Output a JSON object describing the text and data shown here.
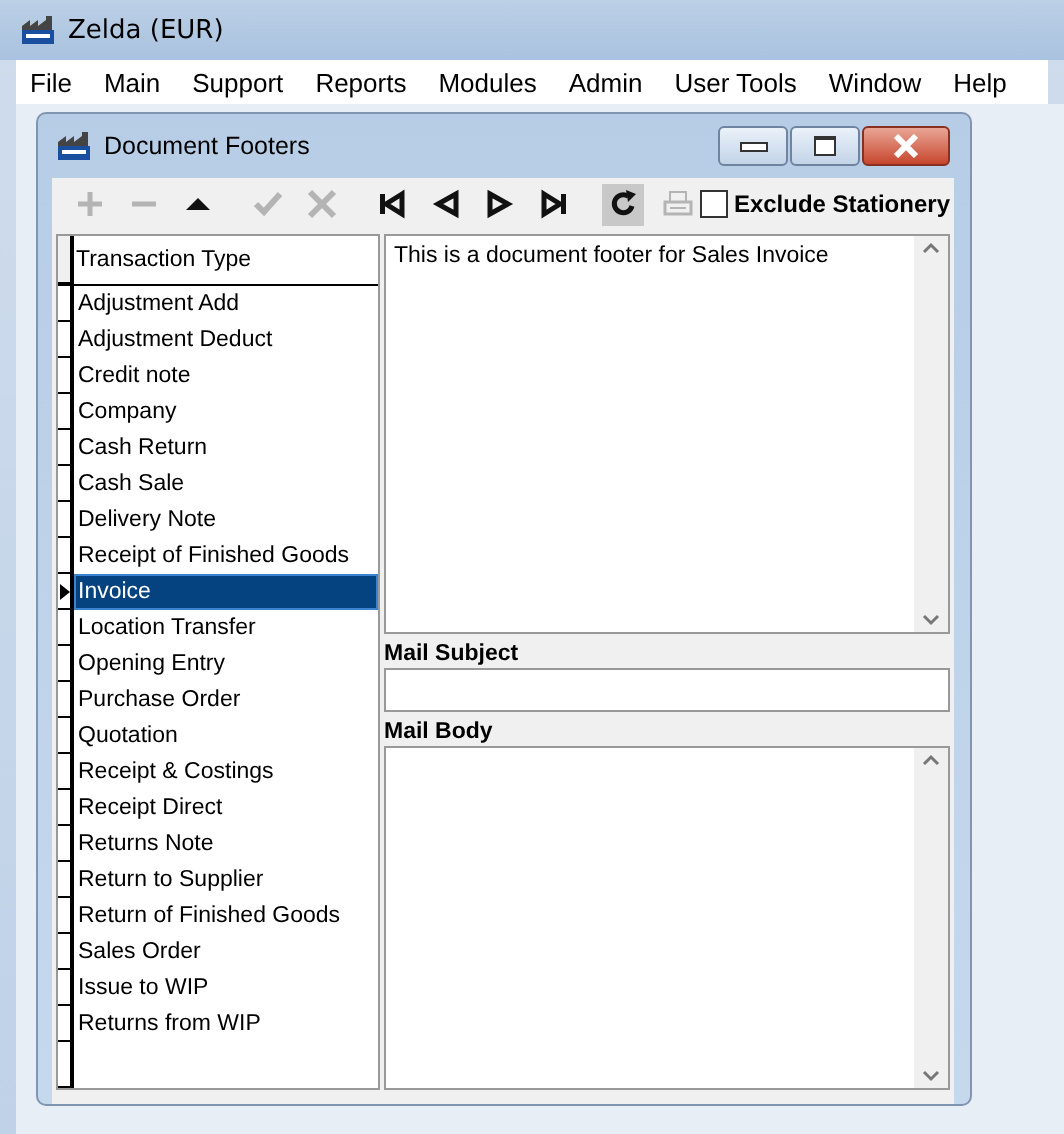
{
  "window": {
    "title": "Zelda (EUR)"
  },
  "menu": [
    "File",
    "Main",
    "Support",
    "Reports",
    "Modules",
    "Admin",
    "User Tools",
    "Window",
    "Help"
  ],
  "dialog": {
    "title": "Document Footers",
    "toolbar": [
      {
        "kind": "add",
        "disabled": true
      },
      {
        "kind": "remove",
        "disabled": true
      },
      {
        "kind": "up",
        "disabled": false
      },
      {
        "kind": "save",
        "disabled": true
      },
      {
        "kind": "cancel",
        "disabled": true
      },
      {
        "kind": "first",
        "disabled": false
      },
      {
        "kind": "prev",
        "disabled": false
      },
      {
        "kind": "next",
        "disabled": false
      },
      {
        "kind": "last",
        "disabled": false
      },
      {
        "kind": "refresh",
        "disabled": false
      },
      {
        "kind": "print",
        "disabled": true
      }
    ],
    "exclude_stationery": {
      "label": "Exclude Stationery",
      "checked": false
    },
    "list": {
      "column": "Transaction Type",
      "rows": [
        {
          "label": "Adjustment Add",
          "selected": false
        },
        {
          "label": "Adjustment Deduct",
          "selected": false
        },
        {
          "label": "Credit note",
          "selected": false
        },
        {
          "label": "Company",
          "selected": false
        },
        {
          "label": "Cash Return",
          "selected": false
        },
        {
          "label": "Cash Sale",
          "selected": false
        },
        {
          "label": "Delivery Note",
          "selected": false
        },
        {
          "label": "Receipt of Finished Goods",
          "selected": false
        },
        {
          "label": "Invoice",
          "selected": true
        },
        {
          "label": "Location Transfer",
          "selected": false
        },
        {
          "label": "Opening Entry",
          "selected": false
        },
        {
          "label": "Purchase Order",
          "selected": false
        },
        {
          "label": "Quotation",
          "selected": false
        },
        {
          "label": "Receipt & Costings",
          "selected": false
        },
        {
          "label": "Receipt Direct",
          "selected": false
        },
        {
          "label": "Returns Note",
          "selected": false
        },
        {
          "label": "Return to Supplier",
          "selected": false
        },
        {
          "label": "Return of Finished Goods",
          "selected": false
        },
        {
          "label": "Sales Order",
          "selected": false
        },
        {
          "label": "Issue to WIP",
          "selected": false
        },
        {
          "label": "Returns from WIP",
          "selected": false
        }
      ]
    },
    "footer_text": "This is a document footer for Sales Invoice",
    "mail_subject": {
      "label": "Mail Subject"
    },
    "mail_body": {
      "label": "Mail Body"
    }
  }
}
